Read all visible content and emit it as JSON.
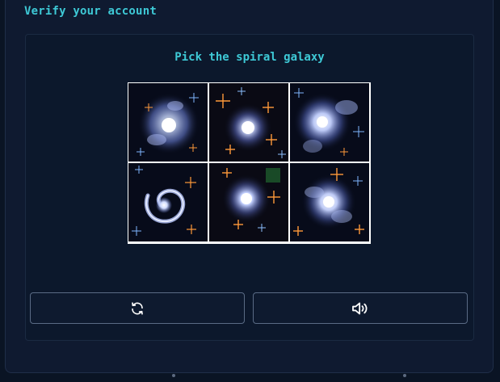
{
  "header": {
    "title": "Verify your account"
  },
  "captcha": {
    "prompt": "Pick the spiral galaxy",
    "tiles": [
      {
        "label": "galaxy-tile-1"
      },
      {
        "label": "galaxy-tile-2"
      },
      {
        "label": "galaxy-tile-3"
      },
      {
        "label": "galaxy-tile-4"
      },
      {
        "label": "galaxy-tile-5"
      },
      {
        "label": "galaxy-tile-6"
      }
    ],
    "refresh_icon": "refresh-icon",
    "audio_icon": "speaker-icon"
  },
  "colors": {
    "accent": "#3ec9d6",
    "background": "#0a1424",
    "panel": "#0f1a30",
    "button_border": "#5a6b85"
  }
}
